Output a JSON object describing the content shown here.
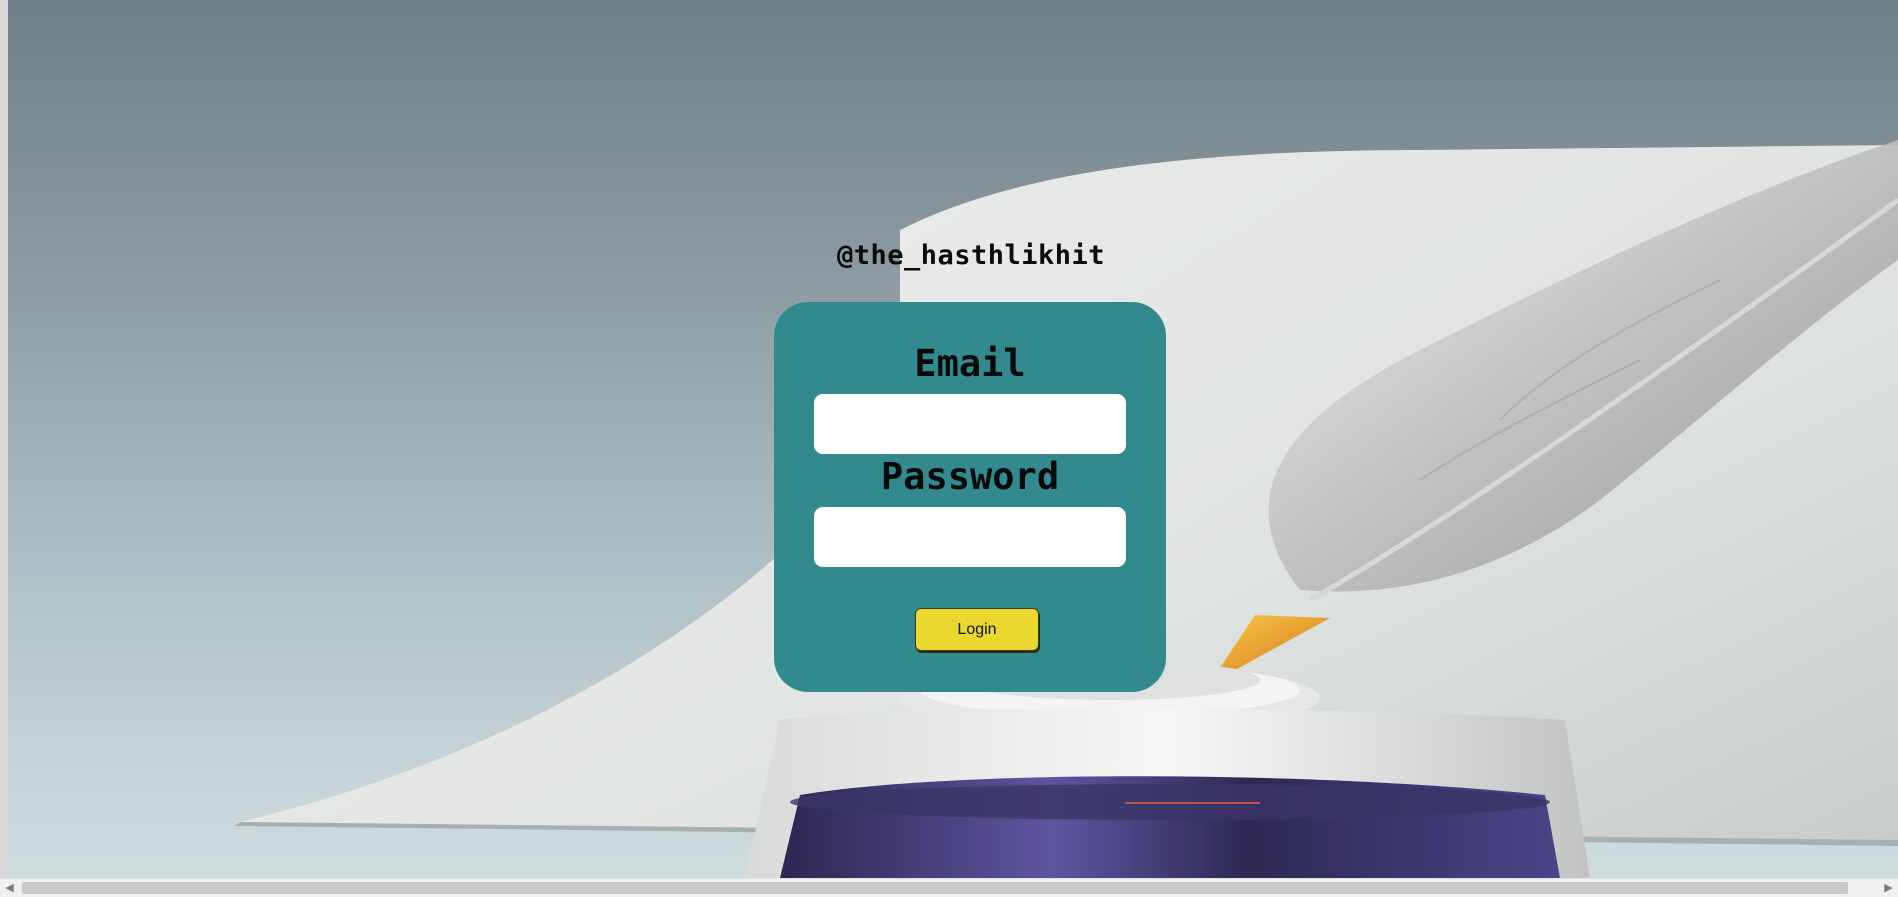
{
  "header": {
    "handle": "@the_hasthlikhit"
  },
  "login_form": {
    "email_label": "Email",
    "email_value": "",
    "password_label": "Password",
    "password_value": "",
    "login_button_label": "Login"
  },
  "scrollbar": {
    "left_arrow": "◀",
    "right_arrow": "▶"
  },
  "colors": {
    "card_background": "#338a8e",
    "button_background": "#e9d82e",
    "page_background": "#8a9aa0"
  }
}
